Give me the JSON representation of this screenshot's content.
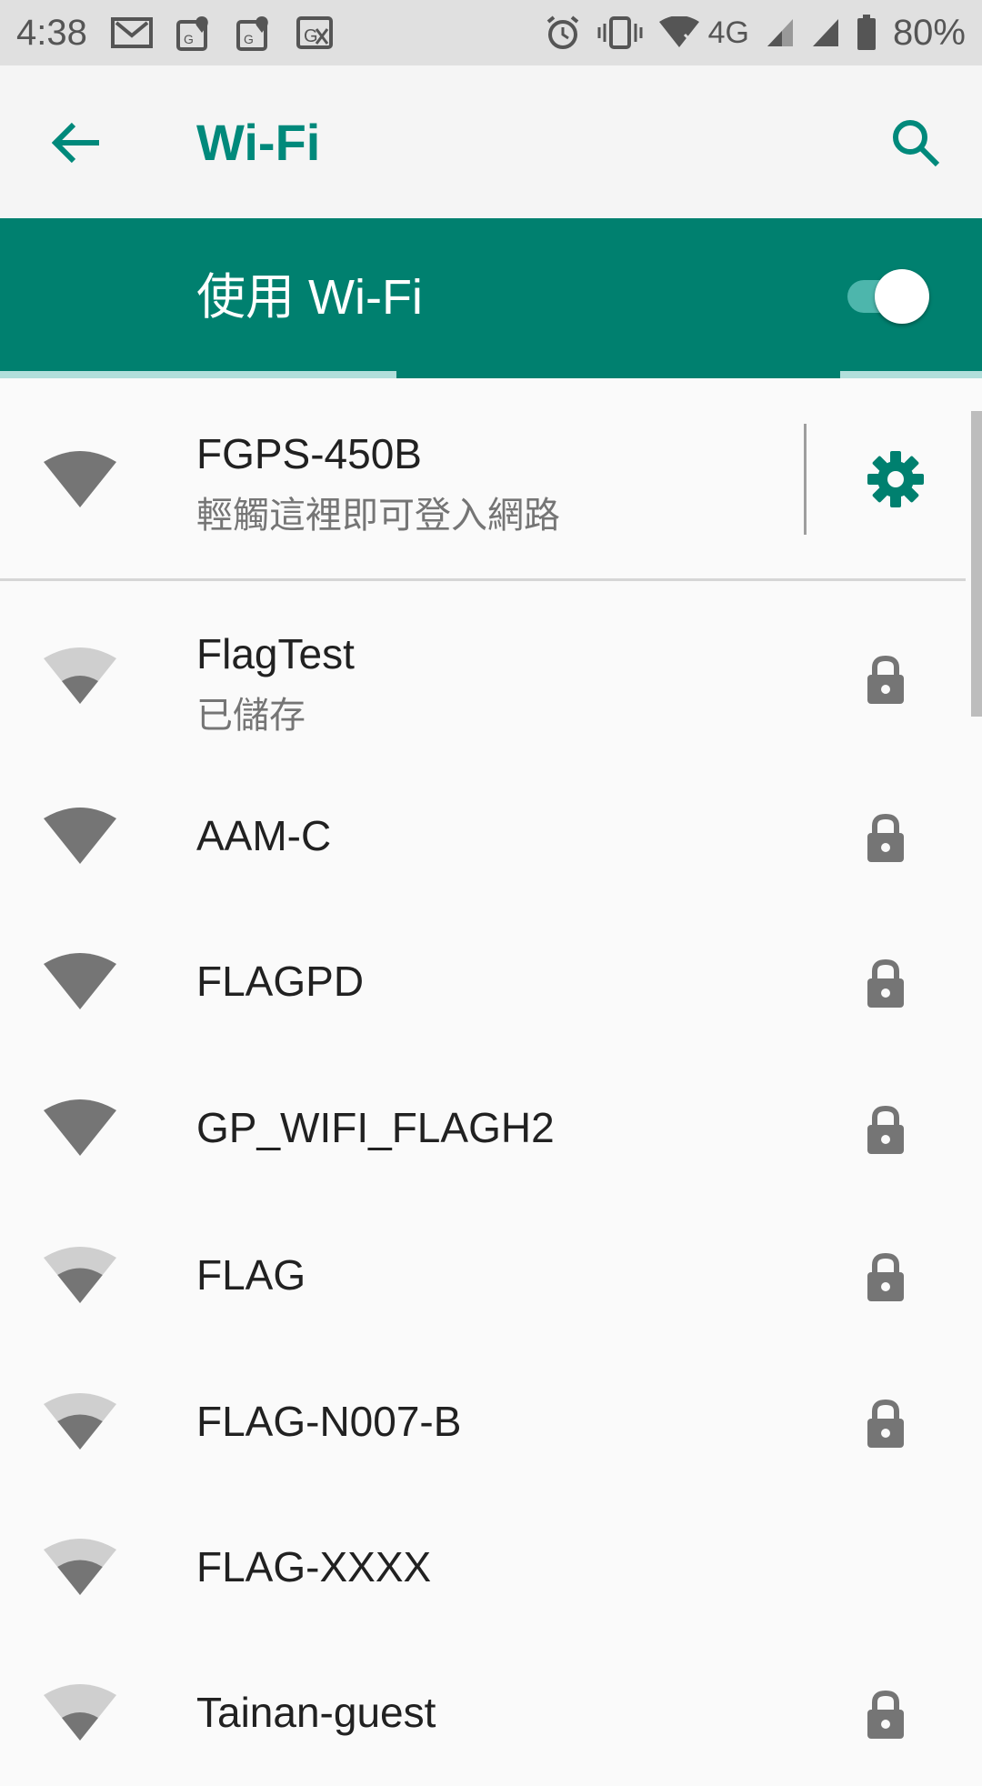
{
  "status_bar": {
    "time": "4:38",
    "network_type": "4G",
    "battery": "80%",
    "icons": [
      "gmail-icon",
      "maps-icon",
      "maps-icon",
      "translate-icon",
      "alarm-icon",
      "vibrate-icon",
      "wifi-icon",
      "signal-icon",
      "signal-icon",
      "battery-icon"
    ]
  },
  "app_bar": {
    "title": "Wi-Fi",
    "back_icon": "arrow-back-icon",
    "search_icon": "search-icon"
  },
  "master_switch": {
    "label": "使用 Wi-Fi",
    "enabled": true
  },
  "connected_network": {
    "name": "FGPS-450B",
    "status": "輕觸這裡即可登入網路",
    "settings_icon": "gear-icon"
  },
  "networks": [
    {
      "name": "FlagTest",
      "status": "已儲存",
      "signal_level": 0.5,
      "secured": true
    },
    {
      "name": "AAM-C",
      "status": "",
      "signal_level": 1.0,
      "secured": true
    },
    {
      "name": "FLAGPD",
      "status": "",
      "signal_level": 1.0,
      "secured": true
    },
    {
      "name": "GP_WIFI_FLAGH2",
      "status": "",
      "signal_level": 1.0,
      "secured": true
    },
    {
      "name": "FLAG",
      "status": "",
      "signal_level": 0.75,
      "secured": true
    },
    {
      "name": "FLAG-N007-B",
      "status": "",
      "signal_level": 0.75,
      "secured": true
    },
    {
      "name": "FLAG-XXXX",
      "status": "",
      "signal_level": 0.75,
      "secured": false
    },
    {
      "name": "Tainan-guest",
      "status": "",
      "signal_level": 0.5,
      "secured": true
    }
  ],
  "colors": {
    "accent": "#00897b",
    "master_bar": "#00806f",
    "icon_gray": "#757575"
  }
}
